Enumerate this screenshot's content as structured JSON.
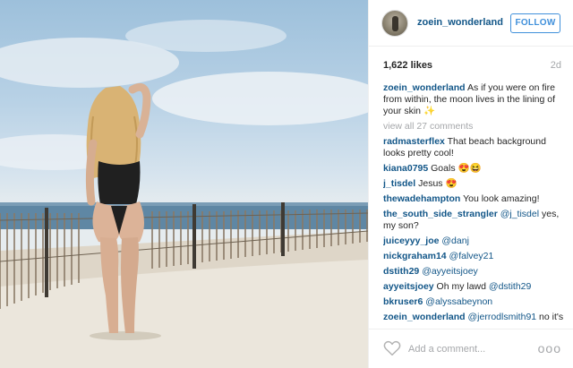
{
  "post": {
    "username": "zoein_wonderland",
    "follow_label": "FOLLOW",
    "likes": "1,622 likes",
    "age": "2d"
  },
  "caption": {
    "user": "zoein_wonderland",
    "text": "As if you were on fire from within, the moon lives in the lining of your skin",
    "emoji": "sparkles"
  },
  "view_all": "view all 27 comments",
  "comments": [
    {
      "user": "radmasterflex",
      "text": "That beach background looks pretty cool!"
    },
    {
      "user": "kiana0795",
      "text": "Goals"
    },
    {
      "user": "j_tisdel",
      "text": "Jesus"
    },
    {
      "user": "thewadehampton",
      "text": "You look amazing!"
    },
    {
      "user": "the_south_side_strangler",
      "mention": "@j_tisdel",
      "text": "yes, my son?"
    },
    {
      "user": "juiceyyy_joe",
      "mention": "@danj",
      "text": ""
    },
    {
      "user": "nickgraham14",
      "mention": "@falvey21",
      "text": ""
    },
    {
      "user": "dstith29",
      "mention": "@ayyeitsjoey",
      "text": ""
    },
    {
      "user": "ayyeitsjoey",
      "text": "Oh my lawd",
      "mention": "@dstith29"
    },
    {
      "user": "bkruser6",
      "mention": "@alyssabeynon",
      "text": ""
    },
    {
      "user": "zoein_wonderland",
      "mention": "@jerrodlsmith91",
      "text": "no it's"
    }
  ],
  "footer": {
    "placeholder": "Add a comment...",
    "more": "ooo"
  },
  "icons": {
    "like": "heart-outline-icon",
    "options": "ellipsis-icon"
  },
  "colors": {
    "link": "#125688",
    "follow": "#4090db",
    "muted": "#a5a7aa"
  }
}
